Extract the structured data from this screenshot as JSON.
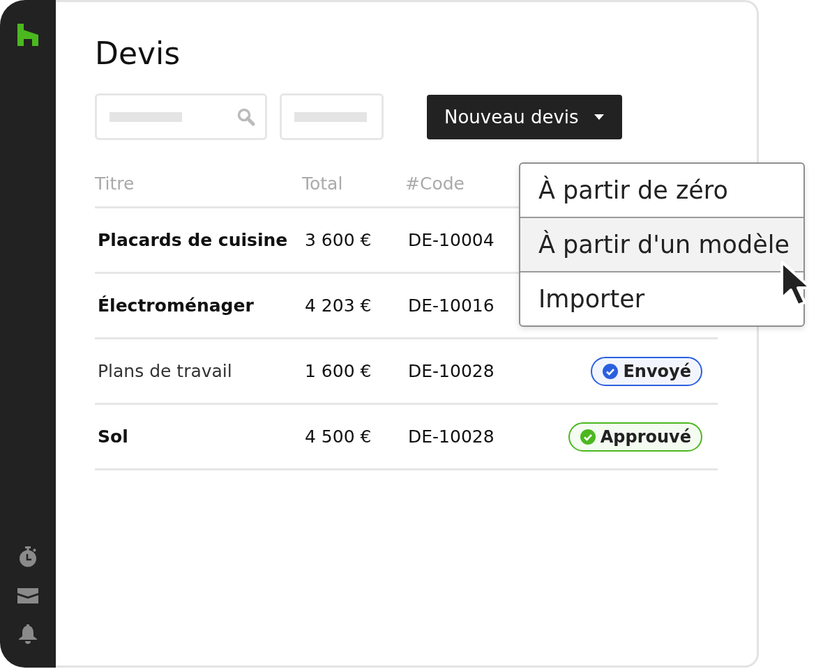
{
  "page": {
    "title": "Devis"
  },
  "toolbar": {
    "new_button": {
      "label": "Nouveau devis"
    }
  },
  "dropdown_menu": {
    "items": [
      {
        "label": "À partir de zéro",
        "selected": false
      },
      {
        "label": "À partir d'un modèle",
        "selected": true
      },
      {
        "label": "Importer",
        "selected": false
      }
    ]
  },
  "table": {
    "columns": [
      "Titre",
      "Total",
      "#Code"
    ],
    "rows": [
      {
        "title": "Placards de cuisine",
        "emphasized": true,
        "total": "3 600 €",
        "code": "DE-10004"
      },
      {
        "title": "Électroménager",
        "emphasized": true,
        "total": "4 203 €",
        "code": "DE-10016"
      },
      {
        "title": "Plans de travail",
        "emphasized": false,
        "total": "1 600 €",
        "code": "DE-10028",
        "status": {
          "label": "Envoyé",
          "color": "#2a5fe0"
        }
      },
      {
        "title": "Sol",
        "emphasized": true,
        "total": "4 500 €",
        "code": "DE-10028",
        "status": {
          "label": "Approuvé",
          "color": "#4bb81f"
        }
      }
    ]
  }
}
